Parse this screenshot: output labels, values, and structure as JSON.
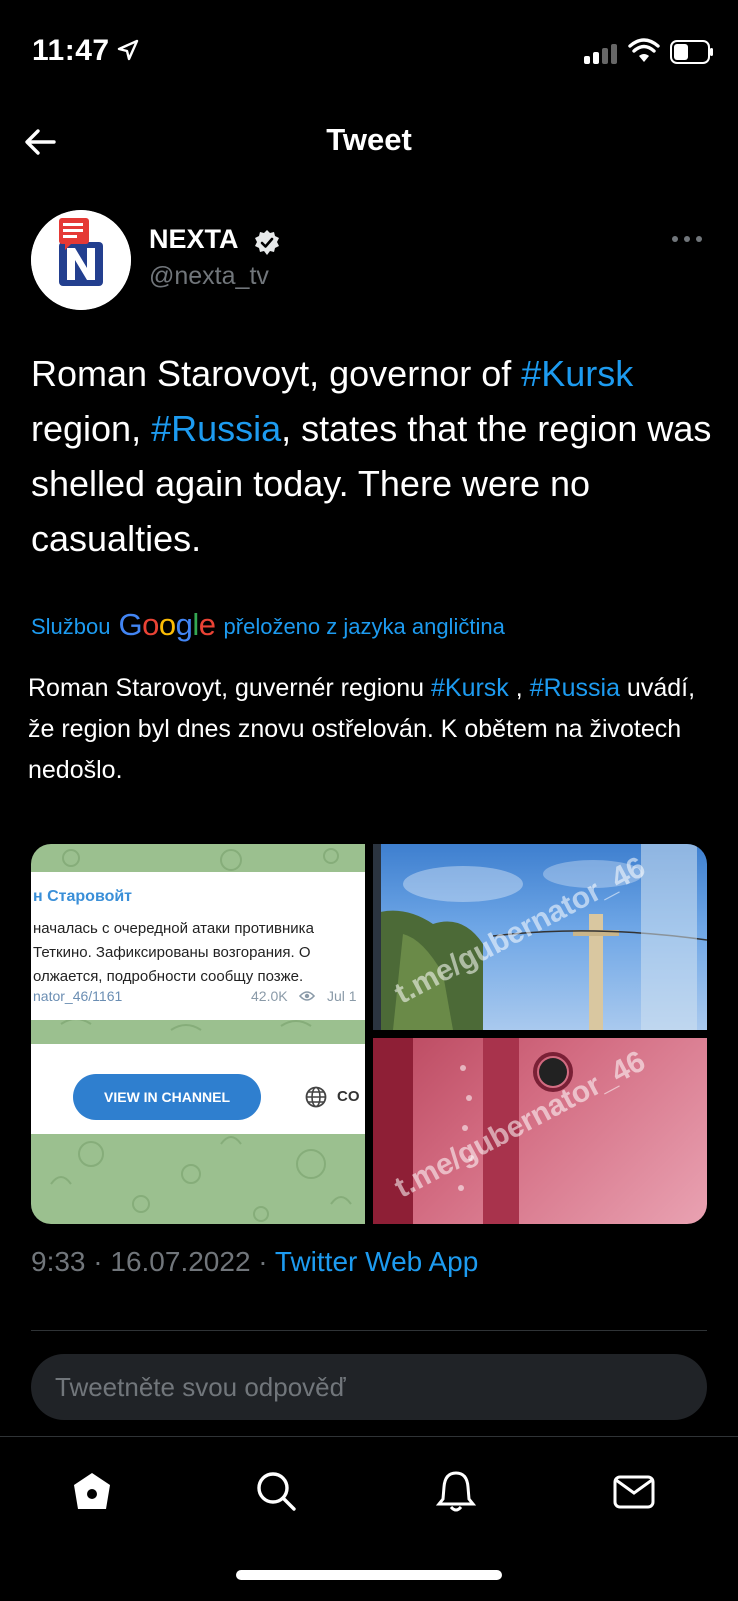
{
  "status_bar": {
    "time": "11:47"
  },
  "header": {
    "title": "Tweet"
  },
  "author": {
    "name": "NEXTA",
    "handle": "@nexta_tv"
  },
  "tweet": {
    "text_parts": [
      "Roman Starovoyt, governor of ",
      "#Kursk",
      " region, ",
      "#Russia",
      ", states that the region was shelled again today. There were no casualties."
    ]
  },
  "translation": {
    "prefix": "Službou",
    "google": "Google",
    "suffix": "přeloženo z jazyka angličtina",
    "text_parts": [
      "Roman Starovoyt, guvernér regionu ",
      "#Kursk",
      " , ",
      "#Russia",
      " uvádí, že region byl dnes znovu ostřelován. K obětem na životech nedošlo."
    ]
  },
  "media": {
    "telegram_card": {
      "channel_name": "н Старовойт",
      "lines": [
        "началась с очередной атаки противника",
        "Теткино. Зафиксированы возгорания. О",
        "олжается, подробности сообщу позже."
      ],
      "link": "nator_46/1161",
      "views": "42.0K",
      "date": "Jul 1",
      "button_label": "VIEW IN CHANNEL",
      "globe_label": "CO"
    },
    "watermark": "t.me/gubernator_46"
  },
  "tweet_meta": {
    "time_date": "9:33 · 16.07.2022 · ",
    "source": "Twitter Web App"
  },
  "reply": {
    "placeholder": "Tweetněte svou odpověď"
  },
  "nav": {
    "items": [
      "home-icon",
      "search-icon",
      "notifications-icon",
      "messages-icon"
    ]
  },
  "colors": {
    "accent": "#1d9bf0",
    "background": "#000000",
    "muted": "#71767b"
  }
}
